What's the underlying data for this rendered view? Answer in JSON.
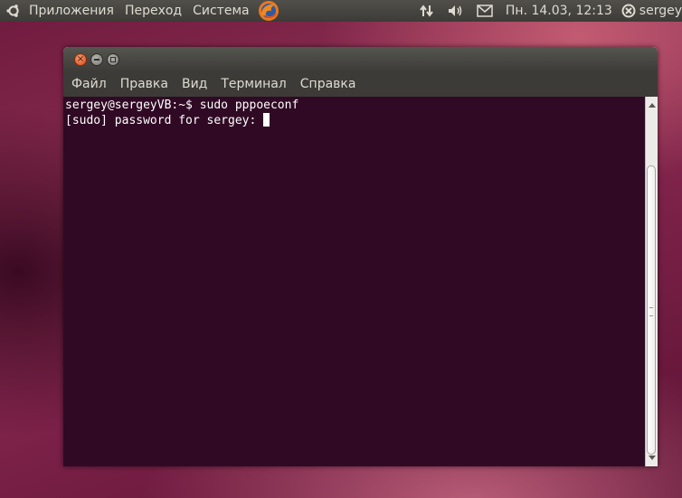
{
  "top_panel": {
    "menus": [
      "Приложения",
      "Переход",
      "Система"
    ],
    "clock": "Пн. 14.03, 12:13",
    "user": "sergey"
  },
  "window": {
    "buttons": [
      "close-icon",
      "minimize-icon",
      "maximize-icon"
    ],
    "menubar": [
      "Файл",
      "Правка",
      "Вид",
      "Терминал",
      "Справка"
    ]
  },
  "terminal": {
    "line1": "sergey@sergeyVB:~$ sudo pppoeconf",
    "line2": "[sudo] password for sergey: "
  },
  "colors": {
    "terminal_bg": "#300a24",
    "panel_bg": "#3c3b37",
    "close_button": "#e05b26"
  }
}
